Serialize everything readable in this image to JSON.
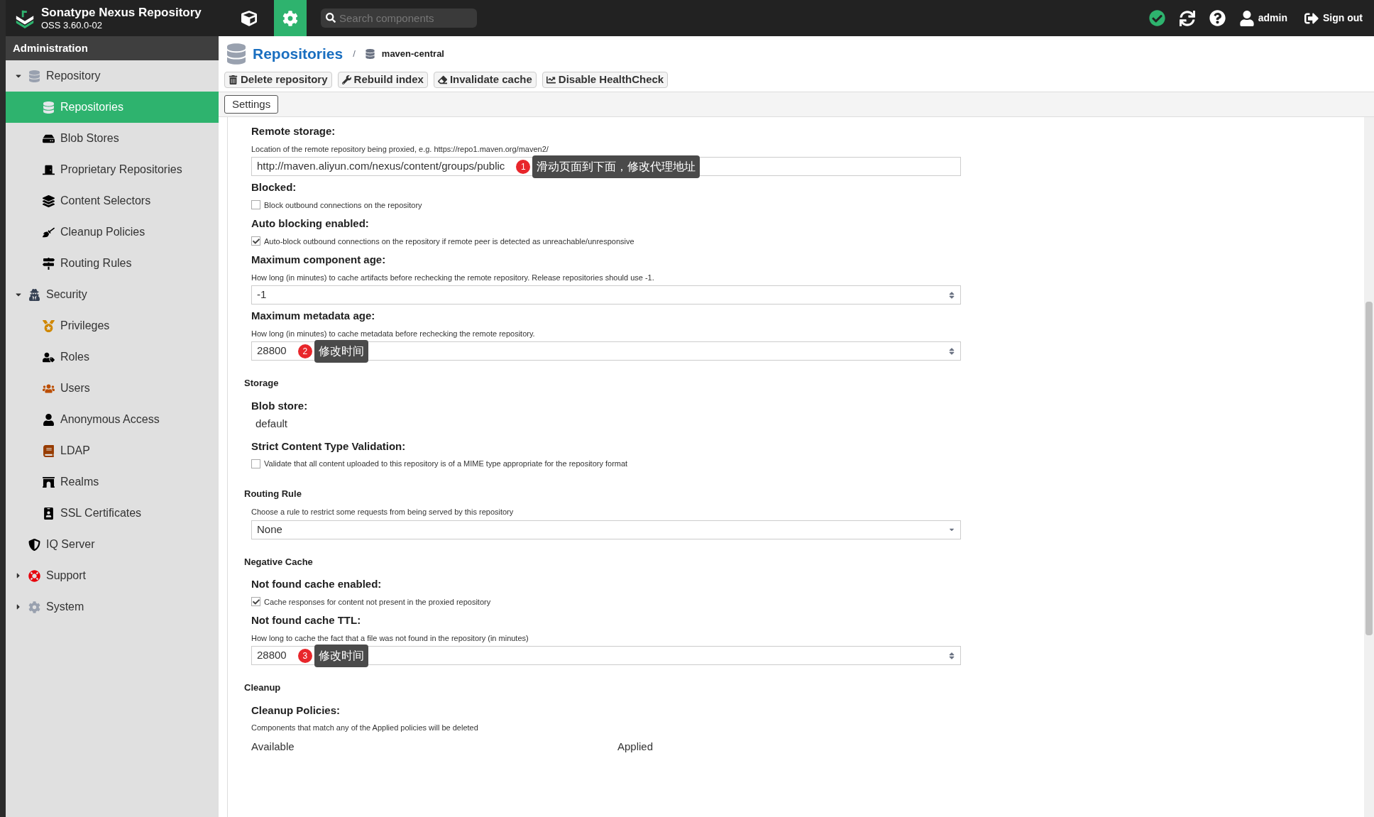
{
  "header": {
    "product": "Sonatype Nexus Repository",
    "version": "OSS 3.60.0-02",
    "search": {
      "placeholder": "Search components"
    },
    "user": "admin",
    "sign_out": "Sign out"
  },
  "sidebar": {
    "title": "Administration",
    "items": [
      {
        "label": "Repository",
        "selected": false,
        "expanded": true,
        "children": [
          {
            "label": "Repositories",
            "selected": true
          },
          {
            "label": "Blob Stores",
            "selected": false
          },
          {
            "label": "Proprietary Repositories",
            "selected": false
          },
          {
            "label": "Content Selectors",
            "selected": false
          },
          {
            "label": "Cleanup Policies",
            "selected": false
          },
          {
            "label": "Routing Rules",
            "selected": false
          }
        ]
      },
      {
        "label": "Security",
        "selected": false,
        "expanded": true,
        "children": [
          {
            "label": "Privileges",
            "selected": false
          },
          {
            "label": "Roles",
            "selected": false
          },
          {
            "label": "Users",
            "selected": false
          },
          {
            "label": "Anonymous Access",
            "selected": false
          },
          {
            "label": "LDAP",
            "selected": false
          },
          {
            "label": "Realms",
            "selected": false
          },
          {
            "label": "SSL Certificates",
            "selected": false
          }
        ]
      },
      {
        "label": "IQ Server",
        "selected": false
      },
      {
        "label": "Support",
        "selected": false,
        "expanded": false
      },
      {
        "label": "System",
        "selected": false,
        "expanded": false
      }
    ]
  },
  "breadcrumb": {
    "title": "Repositories",
    "separator": "/",
    "current": "maven-central"
  },
  "toolbar": [
    "Delete repository",
    "Rebuild index",
    "Invalidate cache",
    "Disable HealthCheck"
  ],
  "tabs": [
    {
      "label": "Settings",
      "selected": true
    }
  ],
  "form": [
    {
      "kind": "label",
      "text": "Remote storage:"
    },
    {
      "kind": "help",
      "text": "Location of the remote repository being proxied, e.g. https://repo1.maven.org/maven2/"
    },
    {
      "kind": "text",
      "value": "http://maven.aliyun.com/nexus/content/groups/public",
      "callout": {
        "number": "1",
        "text": "滑动页面到下面，修改代理地址"
      }
    },
    {
      "kind": "label",
      "text": "Blocked:"
    },
    {
      "kind": "checkbox",
      "text": "Block outbound connections on the repository",
      "checked": false
    },
    {
      "kind": "label",
      "text": "Auto blocking enabled:"
    },
    {
      "kind": "checkbox",
      "text": "Auto-block outbound connections on the repository if remote peer is detected as unreachable/unresponsive",
      "checked": true
    },
    {
      "kind": "label",
      "text": "Maximum component age:"
    },
    {
      "kind": "help",
      "text": "How long (in minutes) to cache artifacts before rechecking the remote repository. Release repositories should use -1."
    },
    {
      "kind": "number",
      "value": "-1"
    },
    {
      "kind": "label",
      "text": "Maximum metadata age:"
    },
    {
      "kind": "help",
      "text": "How long (in minutes) to cache metadata before rechecking the remote repository."
    },
    {
      "kind": "number",
      "value": "28800",
      "callout": {
        "number": "2",
        "text": "修改时间"
      }
    },
    {
      "kind": "section",
      "text": "Storage"
    },
    {
      "kind": "label",
      "text": "Blob store:"
    },
    {
      "kind": "value",
      "text": "default"
    },
    {
      "kind": "label",
      "text": "Strict Content Type Validation:"
    },
    {
      "kind": "checkbox",
      "text": "Validate that all content uploaded to this repository is of a MIME type appropriate for the repository format",
      "checked": false
    },
    {
      "kind": "section",
      "text": "Routing Rule"
    },
    {
      "kind": "help",
      "text": "Choose a rule to restrict some requests from being served by this repository"
    },
    {
      "kind": "select",
      "value": "None"
    },
    {
      "kind": "section",
      "text": "Negative Cache"
    },
    {
      "kind": "label",
      "text": "Not found cache enabled:"
    },
    {
      "kind": "checkbox",
      "text": "Cache responses for content not present in the proxied repository",
      "checked": true
    },
    {
      "kind": "label",
      "text": "Not found cache TTL:"
    },
    {
      "kind": "help",
      "text": "How long to cache the fact that a file was not found in the repository (in minutes)"
    },
    {
      "kind": "number",
      "value": "28800",
      "callout": {
        "number": "3",
        "text": "修改时间"
      }
    },
    {
      "kind": "section",
      "text": "Cleanup"
    },
    {
      "kind": "label",
      "text": "Cleanup Policies:"
    },
    {
      "kind": "help",
      "text": "Components that match any of the Applied policies will be deleted"
    },
    {
      "kind": "columns",
      "texts": [
        "Available",
        "Applied"
      ]
    }
  ]
}
